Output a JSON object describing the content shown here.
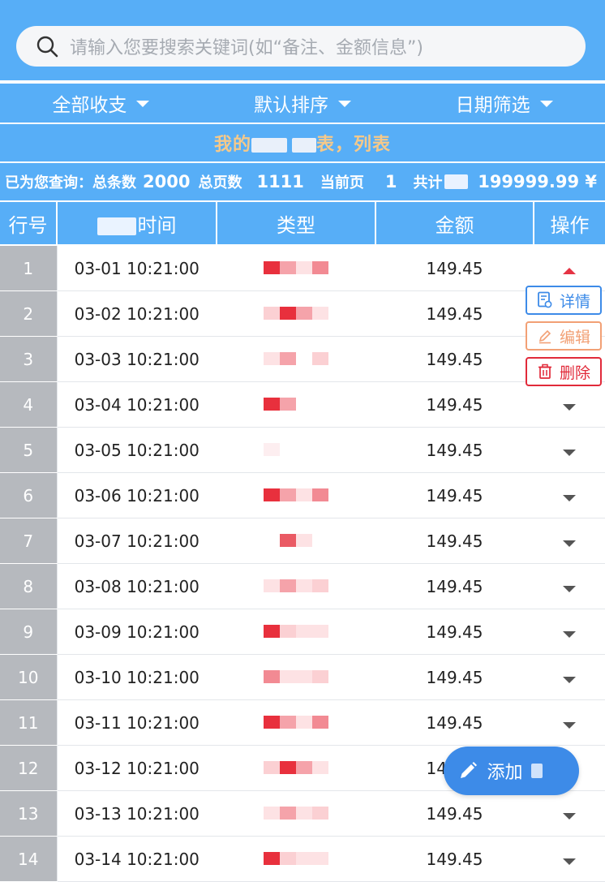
{
  "search": {
    "placeholder": "请输入您要搜索关键词(如“备注、金额信息”)"
  },
  "filters": [
    {
      "label": "全部收支"
    },
    {
      "label": "默认排序"
    },
    {
      "label": "日期筛选"
    }
  ],
  "title": {
    "part1": "我的",
    "part2": "表，列表"
  },
  "info": {
    "query_label": "已为您查询：",
    "total_label": "总条数",
    "total_count": "2000",
    "pages_label": "总页数",
    "pages_count": "1111",
    "current_label": "当前页",
    "current_page": "1",
    "sum_label": "共计",
    "sum_value": "199999.99 ¥"
  },
  "table": {
    "headers": [
      "行号",
      "时间",
      "类型",
      "金额",
      "操作"
    ],
    "rows": [
      {
        "no": "1",
        "time": "03-01 10:21:00",
        "amount": "149.45"
      },
      {
        "no": "2",
        "time": "03-02 10:21:00",
        "amount": "149.45"
      },
      {
        "no": "3",
        "time": "03-03 10:21:00",
        "amount": "149.45"
      },
      {
        "no": "4",
        "time": "03-04 10:21:00",
        "amount": "149.45"
      },
      {
        "no": "5",
        "time": "03-05 10:21:00",
        "amount": "149.45"
      },
      {
        "no": "6",
        "time": "03-06 10:21:00",
        "amount": "149.45"
      },
      {
        "no": "7",
        "time": "03-07 10:21:00",
        "amount": "149.45"
      },
      {
        "no": "8",
        "time": "03-08 10:21:00",
        "amount": "149.45"
      },
      {
        "no": "9",
        "time": "03-09 10:21:00",
        "amount": "149.45"
      },
      {
        "no": "10",
        "time": "03-10 10:21:00",
        "amount": "149.45"
      },
      {
        "no": "11",
        "time": "03-11 10:21:00",
        "amount": "149.45"
      },
      {
        "no": "12",
        "time": "03-12 10:21:00",
        "amount": "149.45"
      },
      {
        "no": "13",
        "time": "03-13 10:21:00",
        "amount": "149.45"
      },
      {
        "no": "14",
        "time": "03-14 10:21:00",
        "amount": "149.45"
      }
    ]
  },
  "actions": {
    "detail_label": "详情",
    "edit_label": "编辑",
    "delete_label": "删除"
  },
  "fab": {
    "label": "添加"
  },
  "colors": {
    "primary": "#57aef7",
    "accent_blue": "#3d8be8",
    "title_gold": "#f5c98a",
    "delete_red": "#e12a3a",
    "edit_orange": "#f2a075",
    "row_index_gray": "#b6b9be"
  }
}
